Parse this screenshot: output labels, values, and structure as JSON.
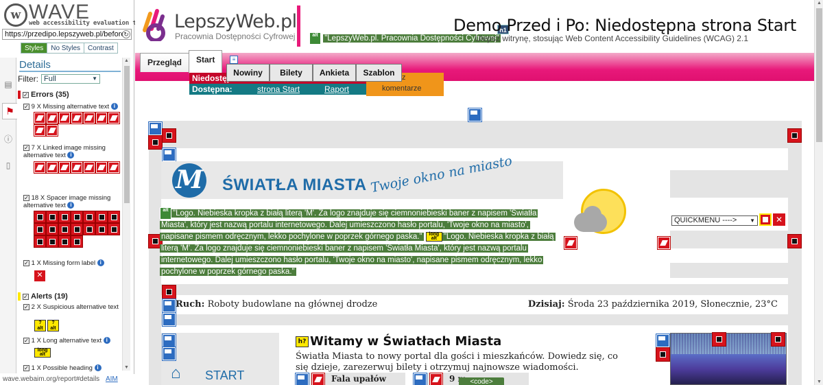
{
  "wave": {
    "logo_word": "WAVE",
    "logo_sub": "web accessibility evaluation tool",
    "url": "https://przedipo.lepszyweb.pl/before/",
    "view_tabs": [
      "Styles",
      "No Styles",
      "Contrast"
    ],
    "details_title": "Details",
    "filter_label": "Filter:",
    "filter_value": "Full",
    "errors_heading": "Errors (35)",
    "alerts_heading": "Alerts (19)",
    "error_items": [
      {
        "label": "9 X Missing alternative text"
      },
      {
        "label": "7 X Linked image missing alternative text"
      },
      {
        "label": "18 X Spacer image missing alternative text"
      },
      {
        "label": "1 X Missing form label"
      }
    ],
    "alert_items": [
      {
        "label": "2 X Suspicious alternative text"
      },
      {
        "label": "1 X Long alternative text"
      },
      {
        "label": "1 X Possible heading"
      }
    ],
    "status_url": "wave.webaim.org/report#details",
    "status_aim": "AIM"
  },
  "site": {
    "brand_name": "LepszyWeb.pl",
    "brand_sub": "Pracownia Dostępności Cyfrowej",
    "h1_badge": "h1",
    "h1": "Demo Przed i Po: Niedostępna strona Start",
    "logo_alt_text": "\"LepszyWeb.pl. Pracownia Dostępności Cyfrowej\"",
    "h1_sub": "Ulepsz witrynę, stosując Web Content Accessibility Guidelines (WCAG) 2.1",
    "alt_badge": "alt",
    "tabs": [
      {
        "label": "Przegląd"
      },
      {
        "label": "Start"
      }
    ],
    "dropdown": [
      {
        "label": "Nowiny"
      },
      {
        "label": "Bilety"
      },
      {
        "label": "Ankieta"
      },
      {
        "label": "Szablon"
      }
    ],
    "row_red_label": "Niedostępna:",
    "row_teal_label": "Dostępna:",
    "row_teal_links": [
      "strona Start",
      "Raport"
    ],
    "orange_text_1": "z",
    "orange_text_2": "komentarze",
    "banner_brand": "ŚWIATŁA MIASTA",
    "banner_motto": "Twoje okno na miasto",
    "banner_m": "M",
    "long_alt_badge": "long alt",
    "alt_text_1": "\"Logo. Niebieska kropka z białą literą 'M'. Za logo znajduje się ciemnoniebieski baner z napisem 'Światła Miasta', który jest nazwą portalu internetowego. Dalej umieszczono hasło portalu, 'Twoje okno na miasto', napisane pismem odręcznym, lekko pochylone w poprzek górnego paska.\"",
    "alt_text_2": "\"Logo. Niebieska kropka z białą literą 'M'. Za logo znajduje się ciemnoniebieski baner z napisem 'Światła Miasta', który jest nazwą portalu internetowego. Dalej umieszczono hasło portalu, 'Twoje okno na miasto', napisane pismem odręcznym, lekko pochylone w poprzek górnego paska.\"",
    "quickmenu": "QUICKMENU ---->",
    "news_label": "Ruch:",
    "news_text": "Roboty budowlane na głównej drodze",
    "today_label": "Dzisiaj:",
    "today_text": "Środa 23 października 2019, Słonecznie, 23°C",
    "start_label": "START",
    "h2_badge": "h?",
    "welcome_title": "Witamy w Światłach Miasta",
    "welcome_text": "Światła Miasta to nowy portal dla gości i mieszkańców. Dowiedz się, co się dzieje, zarezerwuj bilety i otrzymuj najnowsze wiadomości.",
    "card1_title": "Fala upałów",
    "card2_title": "9 m",
    "code_tag": "<code>"
  }
}
